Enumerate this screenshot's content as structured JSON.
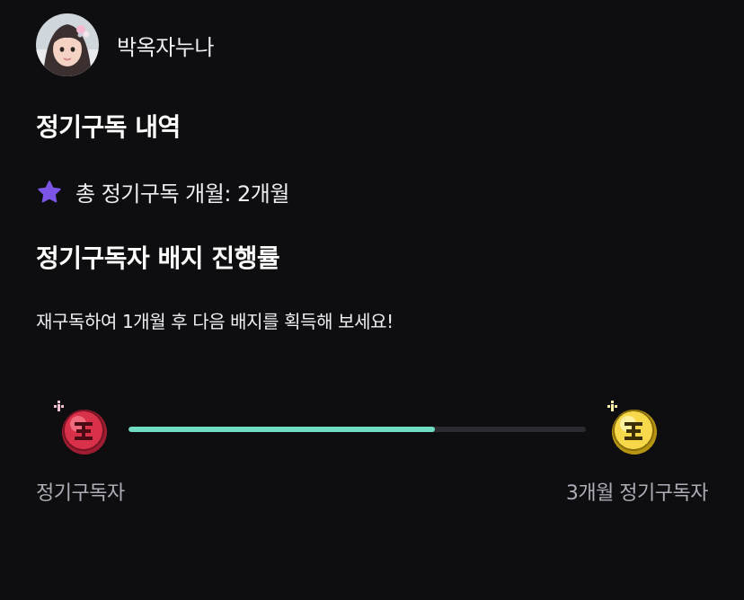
{
  "channel": {
    "name": "박옥자누나",
    "avatar_icon": "avatar-photo"
  },
  "history": {
    "title": "정기구독 내역",
    "total_icon": "star-icon",
    "total_text": "총 정기구독 개월: 2개월"
  },
  "badge_progress": {
    "title": "정기구독자 배지 진행률",
    "hint": "재구독하여 1개월 후 다음 배지를 획득해 보세요!",
    "progress_fraction": 0.67,
    "current_badge": {
      "label": "정기구독자",
      "icon": "red-subscriber-badge-icon",
      "color": "#e0344f"
    },
    "next_badge": {
      "label": "3개월 정기구독자",
      "icon": "gold-subscriber-badge-icon",
      "color": "#f6d84a"
    }
  },
  "colors": {
    "background": "#0e0e10",
    "accent": "#7c55e6",
    "progress_fill": "#6fdcc3",
    "progress_track": "#2a2a30"
  }
}
